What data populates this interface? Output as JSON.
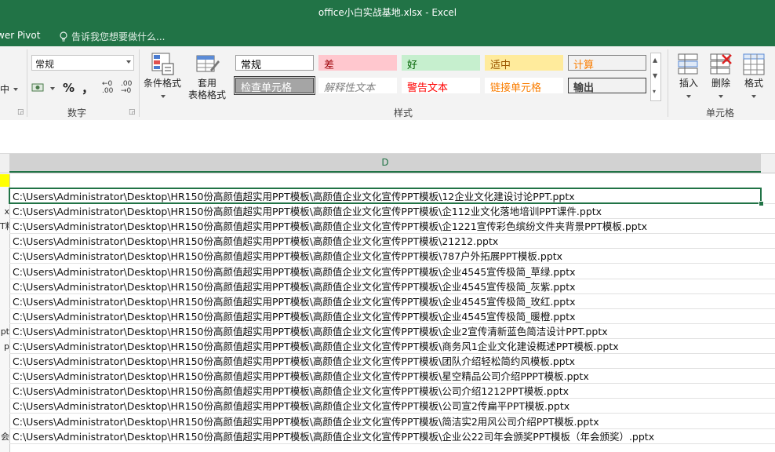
{
  "window": {
    "title": "office小白实战基地.xlsx - Excel"
  },
  "tabs": {
    "power_pivot": "wer Pivot",
    "tell_me": "告诉我您想要做什么..."
  },
  "ribbon": {
    "alignment_partial": "中",
    "number": {
      "format_value": "常规",
      "percent_symbol": "%",
      "comma_symbol": "，",
      "increase_decimal": "←0 .00",
      "decrease_decimal": ".00 →0",
      "group_label": "数字"
    },
    "styles": {
      "conditional_formatting": "条件格式",
      "format_as_table_line1": "套用",
      "format_as_table_line2": "表格格式",
      "cells": [
        {
          "label": "常规",
          "bg": "#ffffff",
          "fg": "#000000",
          "border": "#9b9b9b"
        },
        {
          "label": "差",
          "bg": "#ffc7ce",
          "fg": "#9c0006",
          "border": "#ffc7ce"
        },
        {
          "label": "好",
          "bg": "#c6efce",
          "fg": "#006100",
          "border": "#c6efce"
        },
        {
          "label": "适中",
          "bg": "#ffeb9c",
          "fg": "#9c5700",
          "border": "#ffeb9c"
        },
        {
          "label": "计算",
          "bg": "#f2f2f2",
          "fg": "#fa7d00",
          "border": "#7f7f7f"
        },
        {
          "label": "检查单元格",
          "bg": "#a5a5a5",
          "fg": "#ffffff",
          "border": "#3f3f3f"
        },
        {
          "label": "解释性文本",
          "bg": "#ffffff",
          "fg": "#7f7f7f",
          "border": "#ffffff"
        },
        {
          "label": "警告文本",
          "bg": "#ffffff",
          "fg": "#ff0000",
          "border": "#ffffff"
        },
        {
          "label": "链接单元格",
          "bg": "#ffffff",
          "fg": "#fa7d00",
          "border": "#ffffff"
        },
        {
          "label": "输出",
          "bg": "#f2f2f2",
          "fg": "#3f3f3f",
          "border": "#3f3f3f"
        }
      ],
      "group_label": "样式"
    },
    "cells_group": {
      "insert": "插入",
      "delete": "删除",
      "format": "格式",
      "group_label": "单元格"
    }
  },
  "sheet": {
    "column_header": "D",
    "row_header_fragments": [
      "",
      "x",
      "T料",
      "",
      "",
      "",
      "",
      "",
      "",
      "pt",
      "p",
      "",
      "",
      "",
      "",
      "",
      "会"
    ],
    "rows": [
      "C:\\Users\\Administrator\\Desktop\\HR150份高颜值超实用PPT模板\\高颜值企业文化宣传PPT模板\\12企业文化建设讨论PPT.pptx",
      "C:\\Users\\Administrator\\Desktop\\HR150份高颜值超实用PPT模板\\高颜值企业文化宣传PPT模板\\企112业文化落地培训PPT课件.pptx",
      "C:\\Users\\Administrator\\Desktop\\HR150份高颜值超实用PPT模板\\高颜值企业文化宣传PPT模板\\企1221宣传彩色缤纷文件夹背景PPT模板.pptx",
      "C:\\Users\\Administrator\\Desktop\\HR150份高颜值超实用PPT模板\\高颜值企业文化宣传PPT模板\\21212.pptx",
      "C:\\Users\\Administrator\\Desktop\\HR150份高颜值超实用PPT模板\\高颜值企业文化宣传PPT模板\\787户外拓展PPT模板.pptx",
      "C:\\Users\\Administrator\\Desktop\\HR150份高颜值超实用PPT模板\\高颜值企业文化宣传PPT模板\\企业4545宣传极简_草绿.pptx",
      "C:\\Users\\Administrator\\Desktop\\HR150份高颜值超实用PPT模板\\高颜值企业文化宣传PPT模板\\企业4545宣传极简_灰紫.pptx",
      "C:\\Users\\Administrator\\Desktop\\HR150份高颜值超实用PPT模板\\高颜值企业文化宣传PPT模板\\企业4545宣传极简_玫红.pptx",
      "C:\\Users\\Administrator\\Desktop\\HR150份高颜值超实用PPT模板\\高颜值企业文化宣传PPT模板\\企业4545宣传极简_暖橙.pptx",
      "C:\\Users\\Administrator\\Desktop\\HR150份高颜值超实用PPT模板\\高颜值企业文化宣传PPT模板\\企业2宣传清新蓝色简洁设计PPT.pptx",
      "C:\\Users\\Administrator\\Desktop\\HR150份高颜值超实用PPT模板\\高颜值企业文化宣传PPT模板\\商务风1企业文化建设概述PPT模板.pptx",
      "C:\\Users\\Administrator\\Desktop\\HR150份高颜值超实用PPT模板\\高颜值企业文化宣传PPT模板\\团队介绍轻松简约风模板.pptx",
      "C:\\Users\\Administrator\\Desktop\\HR150份高颜值超实用PPT模板\\高颜值企业文化宣传PPT模板\\星空精品公司介绍PPPT模板.pptx",
      "C:\\Users\\Administrator\\Desktop\\HR150份高颜值超实用PPT模板\\高颜值企业文化宣传PPT模板\\公司介绍1212PPT模板.pptx",
      "C:\\Users\\Administrator\\Desktop\\HR150份高颜值超实用PPT模板\\高颜值企业文化宣传PPT模板\\公司宣2传扁平PPT模板.pptx",
      "C:\\Users\\Administrator\\Desktop\\HR150份高颜值超实用PPT模板\\高颜值企业文化宣传PPT模板\\简洁实2用风公司介绍PPT模板.pptx",
      "C:\\Users\\Administrator\\Desktop\\HR150份高颜值超实用PPT模板\\高颜值企业文化宣传PPT模板\\企业公22司年会颁奖PPT模板（年会颁奖）.pptx"
    ]
  }
}
